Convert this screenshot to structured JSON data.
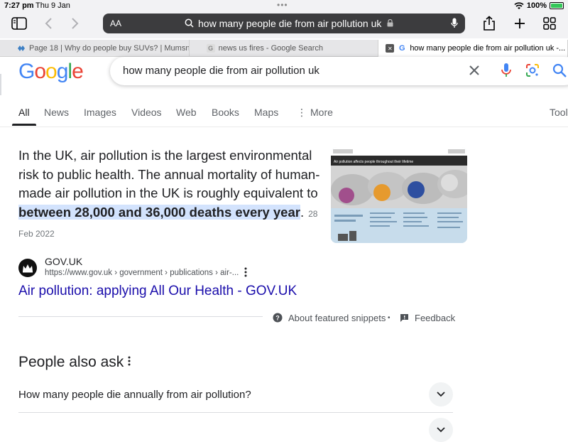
{
  "status": {
    "time": "7:27 pm",
    "date": "Thu 9 Jan",
    "battery": "100%"
  },
  "toolbar": {
    "aa_label": "AA",
    "url": "how many people die from air pollution uk"
  },
  "tabs": [
    {
      "title": "Page 18 | Why do people buy SUVs? | Mumsnet"
    },
    {
      "title": "news us fires - Google Search"
    },
    {
      "title": "how many people die from air pollution uk -..."
    }
  ],
  "google": {
    "logo": [
      "G",
      "o",
      "o",
      "g",
      "l",
      "e"
    ],
    "logo_colors": [
      "#4285f4",
      "#ea4335",
      "#fbbc05",
      "#4285f4",
      "#34a853",
      "#ea4335"
    ],
    "query": "how many people die from air pollution uk"
  },
  "nav": [
    {
      "label": "All"
    },
    {
      "label": "News"
    },
    {
      "label": "Images"
    },
    {
      "label": "Videos"
    },
    {
      "label": "Web"
    },
    {
      "label": "Books"
    },
    {
      "label": "Maps"
    },
    {
      "label": "More"
    },
    {
      "label": "Tool"
    }
  ],
  "snippet": {
    "text_before": "In the UK, air pollution is the largest environmental risk to public health. The annual mortality of human-made air pollution in the UK is roughly equivalent to ",
    "highlight": "between 28,000 and 36,000 deaths every year",
    "text_after": ".",
    "date": "28 Feb 2022"
  },
  "thumbnail": {
    "title": "Air pollution affects people throughout their lifetime"
  },
  "source": {
    "name": "GOV.UK",
    "url": "https://www.gov.uk › government › publications › air-...",
    "link_title": "Air pollution: applying All Our Health - GOV.UK"
  },
  "footer": {
    "about": "About featured snippets",
    "separator": "•",
    "feedback": "Feedback"
  },
  "paa": {
    "title": "People also ask",
    "questions": [
      "How many people die annually from air pollution?"
    ]
  }
}
